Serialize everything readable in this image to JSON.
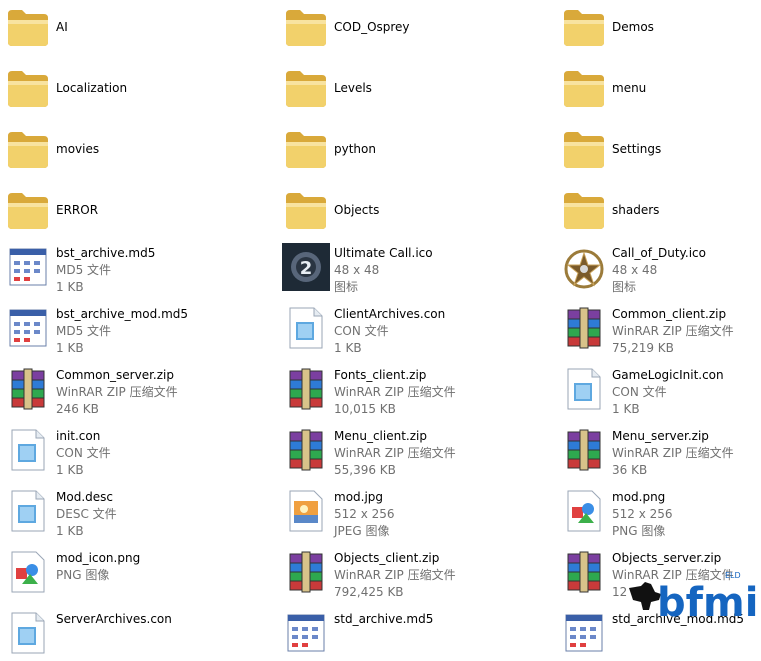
{
  "items": [
    {
      "name": "AI",
      "icon": "folder-icon"
    },
    {
      "name": "COD_Osprey",
      "icon": "folder-icon"
    },
    {
      "name": "Demos",
      "icon": "folder-icon"
    },
    {
      "name": "Localization",
      "icon": "folder-icon"
    },
    {
      "name": "Levels",
      "icon": "folder-icon"
    },
    {
      "name": "menu",
      "icon": "folder-icon"
    },
    {
      "name": "movies",
      "icon": "folder-icon"
    },
    {
      "name": "python",
      "icon": "folder-icon"
    },
    {
      "name": "Settings",
      "icon": "folder-icon"
    },
    {
      "name": " ERROR",
      "icon": "folder-icon"
    },
    {
      "name": "Objects",
      "icon": "folder-icon"
    },
    {
      "name": "shaders",
      "icon": "folder-icon"
    },
    {
      "name": "bst_archive.md5",
      "type": "MD5 文件",
      "size": "1 KB",
      "icon": "md5-file-icon"
    },
    {
      "name": "Ultimate Call.ico",
      "type": "48 x 48",
      "size": "图标",
      "icon": "ultimate-call-ico-icon"
    },
    {
      "name": "Call_of_Duty.ico",
      "type": "48 x 48",
      "size": "图标",
      "icon": "call-of-duty-ico-icon"
    },
    {
      "name": "bst_archive_mod.md5",
      "type": "MD5 文件",
      "size": "1 KB",
      "icon": "md5-file-icon"
    },
    {
      "name": "ClientArchives.con",
      "type": "CON 文件",
      "size": "1 KB",
      "icon": "con-file-icon"
    },
    {
      "name": "Common_client.zip",
      "type": "WinRAR ZIP 压缩文件",
      "size": "75,219 KB",
      "icon": "winrar-zip-icon"
    },
    {
      "name": "Common_server.zip",
      "type": "WinRAR ZIP 压缩文件",
      "size": "246 KB",
      "icon": "winrar-zip-icon"
    },
    {
      "name": "Fonts_client.zip",
      "type": "WinRAR ZIP 压缩文件",
      "size": "10,015 KB",
      "icon": "winrar-zip-icon"
    },
    {
      "name": "GameLogicInit.con",
      "type": "CON 文件",
      "size": "1 KB",
      "icon": "con-file-icon"
    },
    {
      "name": "init.con",
      "type": "CON 文件",
      "size": "1 KB",
      "icon": "con-file-icon"
    },
    {
      "name": "Menu_client.zip",
      "type": "WinRAR ZIP 压缩文件",
      "size": "55,396 KB",
      "icon": "winrar-zip-icon"
    },
    {
      "name": "Menu_server.zip",
      "type": "WinRAR ZIP 压缩文件",
      "size": "36 KB",
      "icon": "winrar-zip-icon"
    },
    {
      "name": "Mod.desc",
      "type": "DESC 文件",
      "size": "1 KB",
      "icon": "desc-file-icon"
    },
    {
      "name": "mod.jpg",
      "type": "512 x 256",
      "size": "JPEG 图像",
      "icon": "jpeg-image-icon"
    },
    {
      "name": "mod.png",
      "type": "512 x 256",
      "size": "PNG 图像",
      "icon": "png-image-icon"
    },
    {
      "name": "mod_icon.png",
      "type": "PNG 图像",
      "size": "",
      "icon": "png-image-icon"
    },
    {
      "name": "Objects_client.zip",
      "type": "WinRAR ZIP 压缩文件",
      "size": "792,425 KB",
      "icon": "winrar-zip-icon"
    },
    {
      "name": "Objects_server.zip",
      "type": "WinRAR ZIP 压缩文件",
      "size": "12",
      "icon": "winrar-zip-icon"
    },
    {
      "name": "ServerArchives.con",
      "type": "",
      "size": "",
      "icon": "con-file-icon"
    },
    {
      "name": "std_archive.md5",
      "type": "",
      "size": "",
      "icon": "md5-file-icon"
    },
    {
      "name": "std_archive_mod.md5",
      "type": "",
      "size": "",
      "icon": "md5-file-icon"
    }
  ],
  "watermark": {
    "text": "bfmil",
    "small": "ELD",
    "icon": "soldier-silhouette-icon"
  },
  "colors": {
    "folder": "#f2d16b",
    "folder_dark": "#d9a93a",
    "text_gray": "#707070",
    "watermark_blue": "#1565c0"
  }
}
